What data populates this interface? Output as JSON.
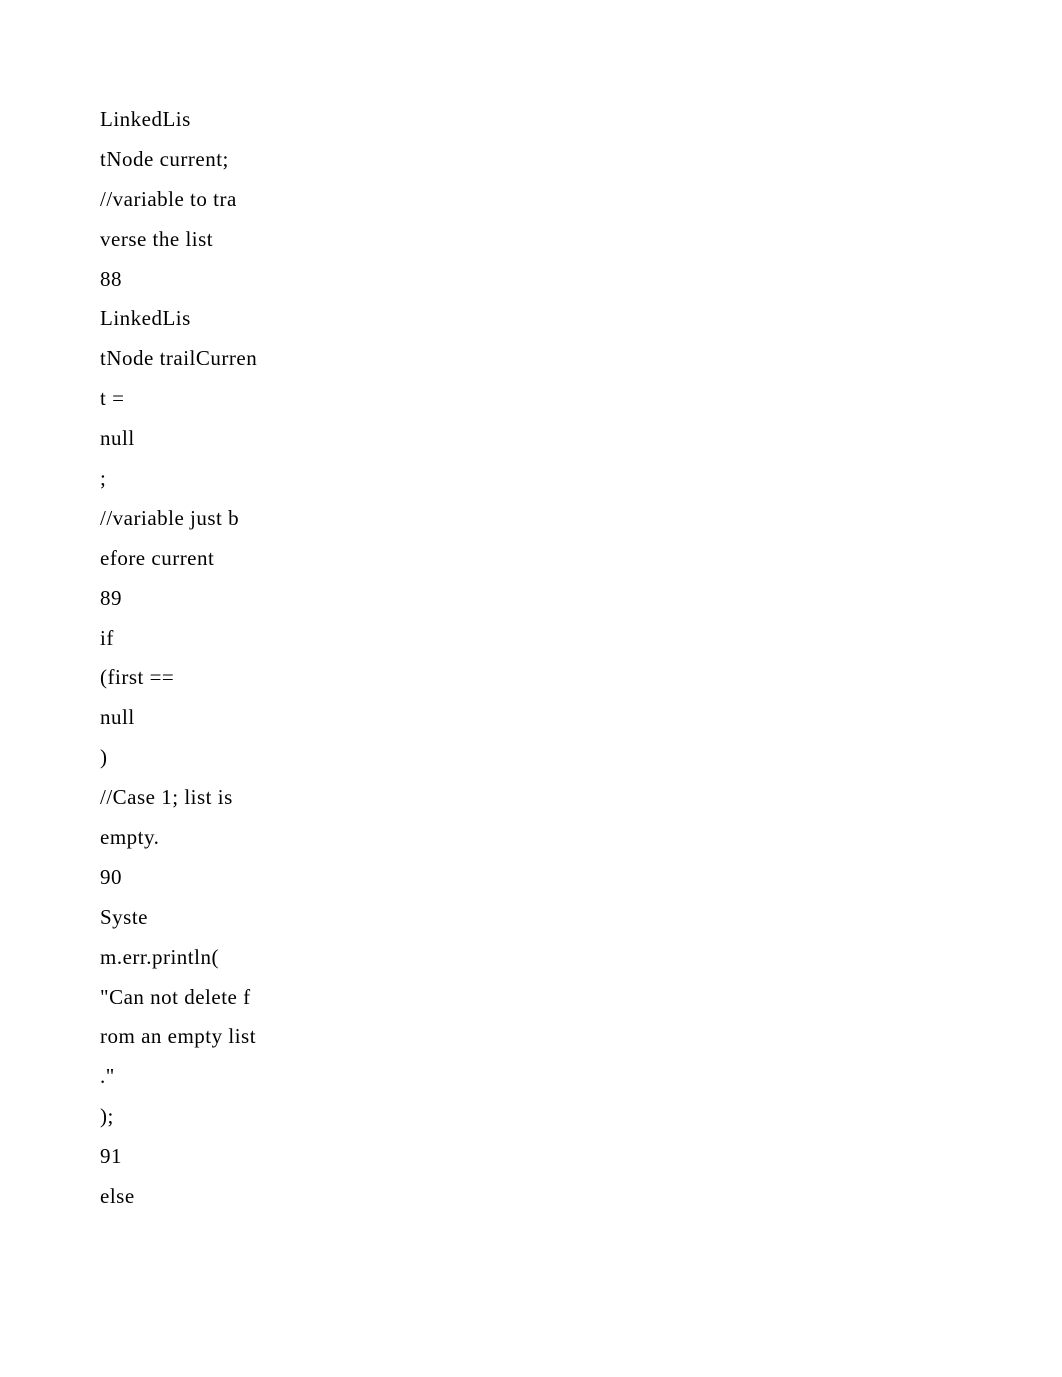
{
  "lines": [
    "LinkedLis",
    "tNode current;",
    "//variable to tra",
    "verse the list",
    "88",
    "LinkedLis",
    "tNode trailCurren",
    "t =",
    "null",
    ";",
    "//variable just b",
    "efore current",
    "89",
    "if",
    "(first ==",
    "null",
    ")",
    "//Case 1; list is",
    "empty.",
    "90",
    "Syste",
    "m.err.println(",
    "\"Can not delete f",
    "rom an empty list",
    ".\"",
    ");",
    "91",
    "else"
  ]
}
